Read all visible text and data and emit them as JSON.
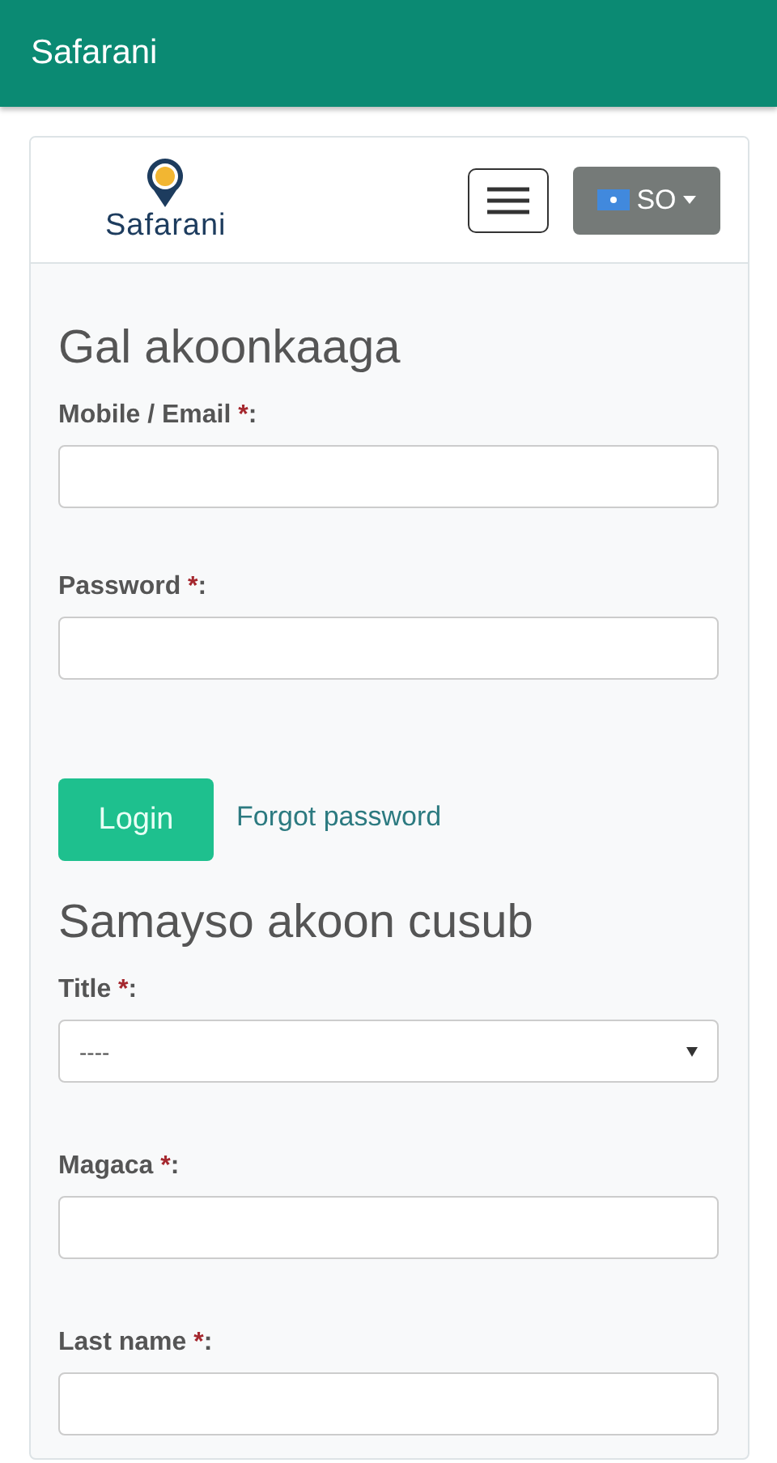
{
  "app_bar": {
    "title": "Safarani"
  },
  "header": {
    "logo_text": "Safarani",
    "language": {
      "code": "SO"
    }
  },
  "login": {
    "heading": "Gal akoonkaaga",
    "fields": [
      {
        "kind": "input",
        "label": "Mobile / Email",
        "required_mark": "*",
        "suffix": ":"
      },
      {
        "kind": "input",
        "label": "Password",
        "required_mark": "*",
        "suffix": ":"
      }
    ],
    "button": "Login",
    "forgot_link": "Forgot password"
  },
  "register": {
    "heading": "Samayso akoon cusub",
    "fields": [
      {
        "kind": "select",
        "label": "Title",
        "required_mark": "*",
        "suffix": ":",
        "value": "----"
      },
      {
        "kind": "input",
        "label": "Magaca",
        "required_mark": "*",
        "suffix": ":"
      },
      {
        "kind": "input",
        "label": "Last name",
        "required_mark": "*",
        "suffix": ":"
      }
    ]
  }
}
